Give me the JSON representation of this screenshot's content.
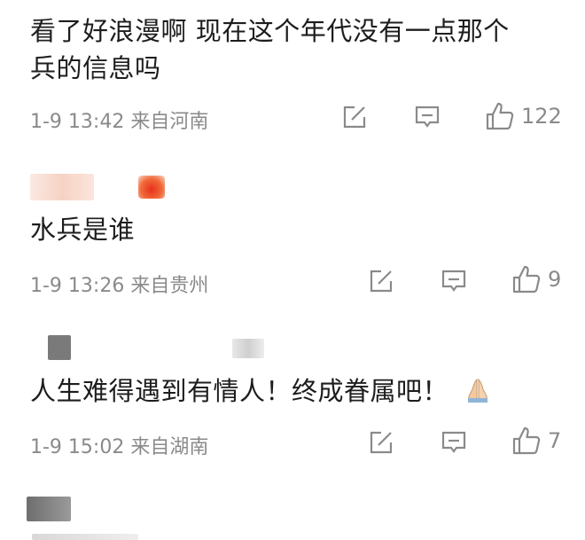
{
  "comments": [
    {
      "text_line1": "看了好浪漫啊  现在这个年代没有一点那个",
      "text_line2": "兵的信息吗",
      "meta": "1-9 13:42 来自河南",
      "likes": "122",
      "icons": [
        "edit-icon",
        "comment-icon",
        "like-icon"
      ]
    },
    {
      "text": "水兵是谁",
      "meta": "1-9 13:26 来自贵州",
      "likes": "9",
      "icons": [
        "edit-icon",
        "comment-icon",
        "like-icon"
      ]
    },
    {
      "text": "人生难得遇到有情人！终成眷属吧！",
      "emoji": "praying-hands-emoji",
      "meta": "1-9 15:02 来自湖南",
      "likes": "7",
      "icons": [
        "edit-icon",
        "comment-icon",
        "like-icon"
      ]
    }
  ],
  "colors": {
    "text": "#1d1d1d",
    "meta": "#8a8a8a",
    "background": "#ffffff"
  }
}
